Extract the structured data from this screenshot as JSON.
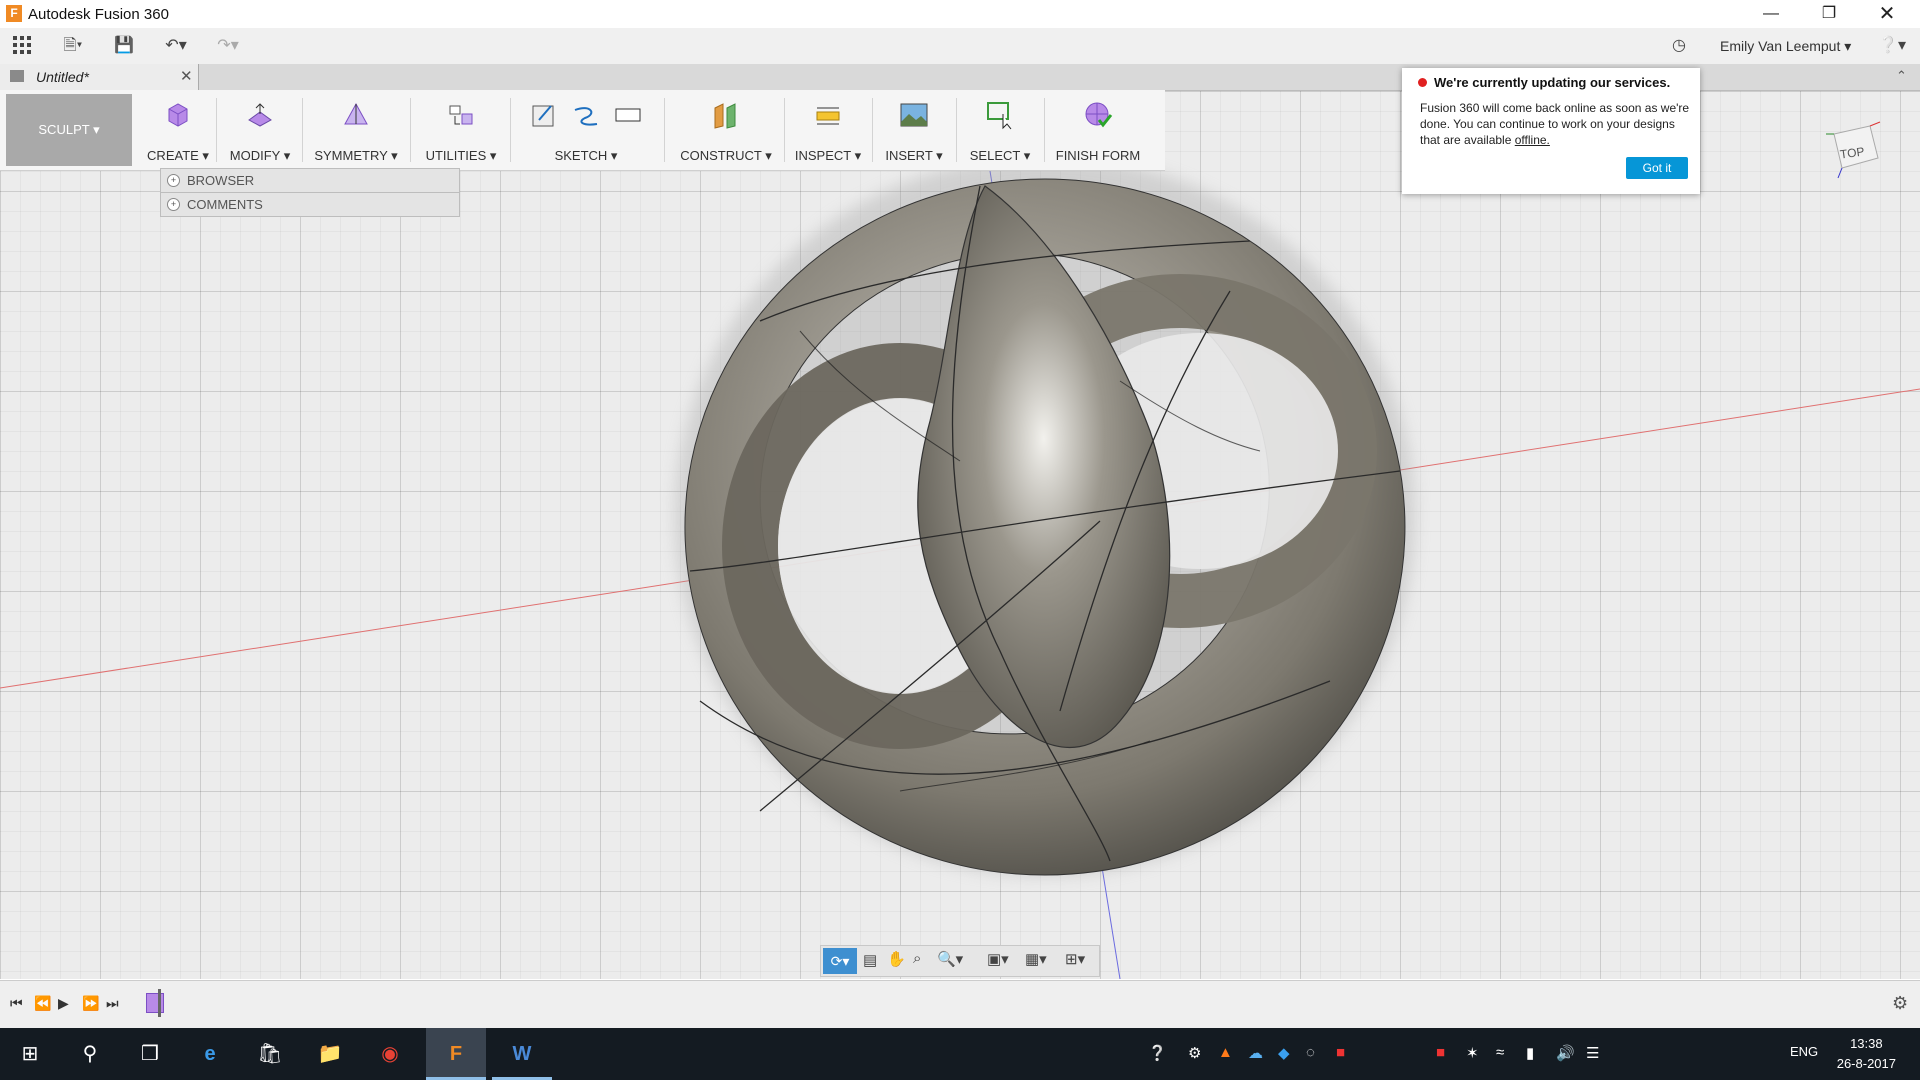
{
  "window": {
    "title": "Autodesk Fusion 360"
  },
  "qat": {
    "user_name": "Emily Van Leemput"
  },
  "document": {
    "tab_title": "Untitled*"
  },
  "toolbar": {
    "workspace": "SCULPT",
    "groups": [
      {
        "label": "CREATE"
      },
      {
        "label": "MODIFY"
      },
      {
        "label": "SYMMETRY"
      },
      {
        "label": "UTILITIES"
      },
      {
        "label": "SKETCH"
      },
      {
        "label": "CONSTRUCT"
      },
      {
        "label": "INSPECT"
      },
      {
        "label": "INSERT"
      },
      {
        "label": "SELECT"
      },
      {
        "label": "FINISH FORM"
      }
    ]
  },
  "browser": {
    "browser_label": "BROWSER",
    "comments_label": "COMMENTS"
  },
  "notification": {
    "heading": "We're currently updating our services.",
    "body": "Fusion 360 will come back online as soon as we're done. You can continue to work on your designs that are available",
    "link": "offline.",
    "button": "Got it"
  },
  "viewcube": {
    "face": "TOP"
  },
  "taskbar": {
    "language": "ENG",
    "time": "13:38",
    "date": "26-8-2017"
  },
  "colors": {
    "accent": "#0696d7",
    "sculpt_purple": "#9b6bd6",
    "taskbar": "#141b22"
  }
}
